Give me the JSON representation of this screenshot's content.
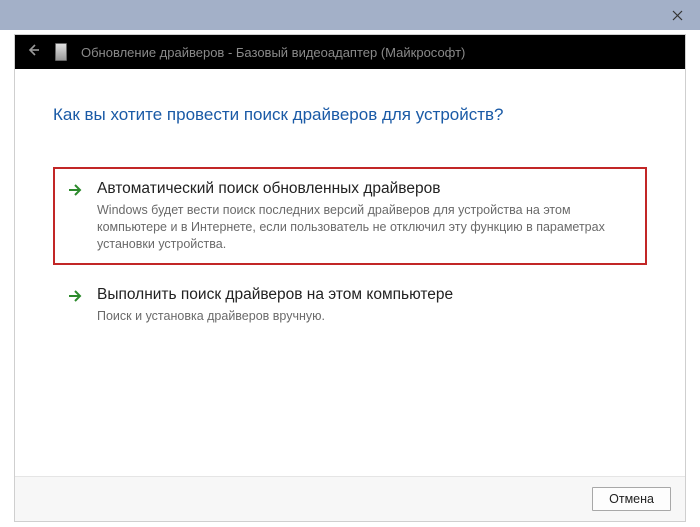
{
  "header": {
    "title": "Обновление драйверов - Базовый видеоадаптер (Майкрософт)"
  },
  "question": "Как вы хотите провести поиск драйверов для устройств?",
  "options": {
    "auto": {
      "heading": "Автоматический поиск обновленных драйверов",
      "desc": "Windows будет вести поиск последних версий драйверов для устройства на этом компьютере и в Интернете, если пользователь не отключил эту функцию в параметрах установки устройства."
    },
    "manual": {
      "heading": "Выполнить поиск драйверов на этом компьютере",
      "desc": "Поиск и установка драйверов вручную."
    }
  },
  "buttons": {
    "cancel": "Отмена"
  }
}
